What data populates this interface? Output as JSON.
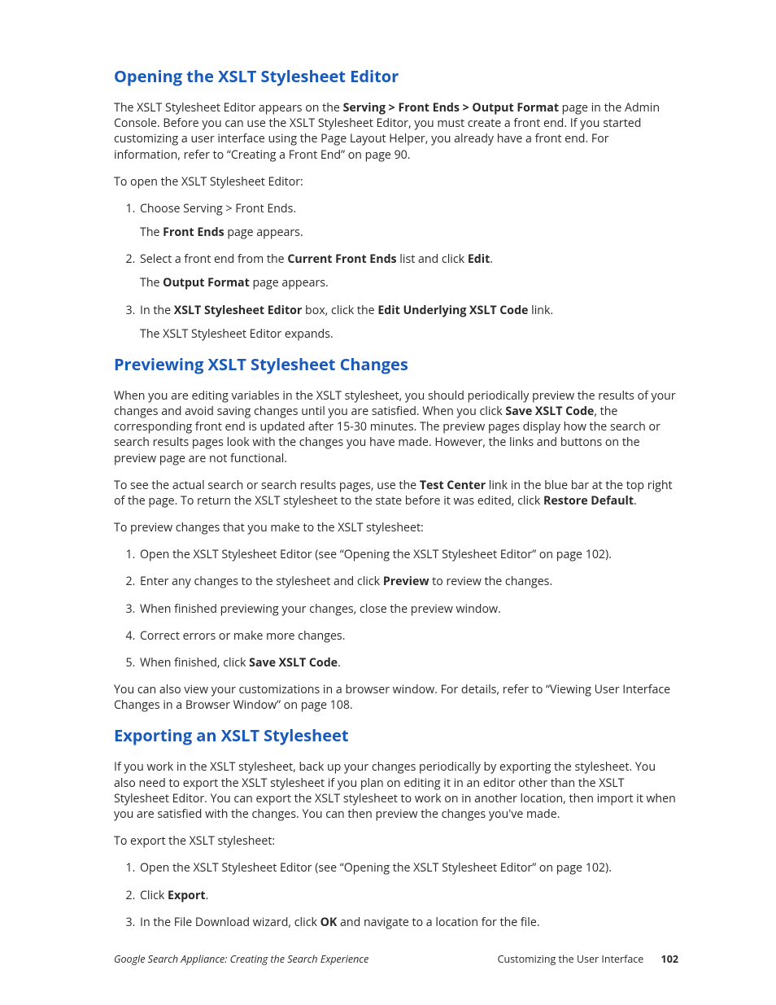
{
  "section1": {
    "heading": "Opening the XSLT Stylesheet Editor",
    "p1_a": "The XSLT Stylesheet Editor appears on the ",
    "p1_b1": "Serving > Front Ends > Output Format",
    "p1_c": " page in the Admin Console. Before you can use the XSLT Stylesheet Editor, you must create a front end. If you started customizing a user interface using the Page Layout Helper, you already have a front end. For information, refer to “Creating a Front End” on page 90.",
    "p2": "To open the XSLT Stylesheet Editor:",
    "li1": "Choose Serving > Front Ends.",
    "li1_sub_a": "The ",
    "li1_sub_b": "Front Ends",
    "li1_sub_c": " page appears.",
    "li2_a": "Select a front end from the ",
    "li2_b": "Current Front Ends",
    "li2_c": " list and click ",
    "li2_d": "Edit",
    "li2_e": ".",
    "li2_sub_a": "The ",
    "li2_sub_b": "Output Format",
    "li2_sub_c": " page appears.",
    "li3_a": "In the ",
    "li3_b": "XSLT Stylesheet Editor",
    "li3_c": " box, click the ",
    "li3_d": "Edit Underlying XSLT Code",
    "li3_e": " link.",
    "li3_sub": "The XSLT Stylesheet Editor expands."
  },
  "section2": {
    "heading": "Previewing XSLT Stylesheet Changes",
    "p1_a": "When you are editing variables in the XSLT stylesheet, you should periodically preview the results of your changes and avoid saving changes until you are satisfied. When you click ",
    "p1_b": "Save XSLT Code",
    "p1_c": ", the corresponding front end is updated after 15-30 minutes. The preview pages display how the search or search results pages look with the changes you have made. However, the links and buttons on the preview page are not functional.",
    "p2_a": "To see the actual search or search results pages, use the ",
    "p2_b": "Test Center",
    "p2_c": " link in the blue bar at the top right of the page. To return the XSLT stylesheet to the state before it was edited, click ",
    "p2_d": "Restore Default",
    "p2_e": ".",
    "p3": "To preview changes that you make to the XSLT stylesheet:",
    "li1": "Open the XSLT Stylesheet Editor (see “Opening the XSLT Stylesheet Editor” on page 102).",
    "li2_a": "Enter any changes to the stylesheet and click ",
    "li2_b": "Preview",
    "li2_c": " to review the changes.",
    "li3": "When finished previewing your changes, close the preview window.",
    "li4": "Correct errors or make more changes.",
    "li5_a": "When finished, click ",
    "li5_b": "Save XSLT Code",
    "li5_c": ".",
    "p4": "You can also view your customizations in a browser window. For details, refer to “Viewing User Interface Changes in a Browser Window” on page 108."
  },
  "section3": {
    "heading": "Exporting an XSLT Stylesheet",
    "p1": "If you work in the XSLT stylesheet, back up your changes periodically by exporting the stylesheet. You also need to export the XSLT stylesheet if you plan on editing it in an editor other than the XSLT Stylesheet Editor. You can export the XSLT stylesheet to work on in another location, then import it when you are satisfied with the changes. You can then preview the changes you've made.",
    "p2": "To export the XSLT stylesheet:",
    "li1": "Open the XSLT Stylesheet Editor (see “Opening the XSLT Stylesheet Editor” on page 102).",
    "li2_a": "Click ",
    "li2_b": "Export",
    "li2_c": ".",
    "li3_a": "In the File Download wizard, click ",
    "li3_b": "OK",
    "li3_c": " and navigate to a location for the file."
  },
  "footer": {
    "left": "Google Search Appliance: Creating the Search Experience",
    "right_label": "Customizing the User Interface",
    "page": "102"
  }
}
